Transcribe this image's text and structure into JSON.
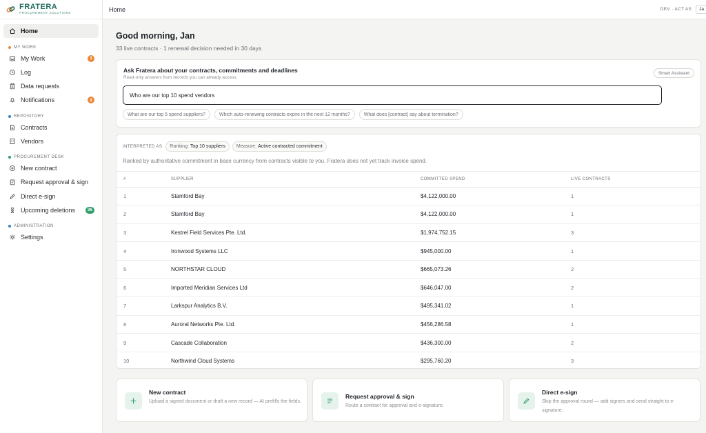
{
  "app": {
    "logo_name": "FRATERA",
    "logo_tagline": "PROCUREMENT SOLUTIONS"
  },
  "colors": {
    "accent": "#1f6b5c",
    "badge_orange": "#e8893a",
    "badge_green": "#2f9e6a",
    "section_my_work": "#e8893a",
    "section_repository": "#3b82c4",
    "section_procurement": "#2f9e6a",
    "section_admin": "#3b82c4"
  },
  "sidebar": {
    "home": {
      "label": "Home",
      "icon": "home-icon"
    },
    "sections": {
      "my_work": "MY WORK",
      "repository": "REPOSITORY",
      "procurement": "PROCUREMENT DESK",
      "admin": "ADMINISTRATION"
    },
    "my_work": [
      {
        "label": "My Work",
        "icon": "inbox-icon",
        "badge": "1"
      },
      {
        "label": "Log",
        "icon": "clock-icon"
      },
      {
        "label": "Data requests",
        "icon": "clipboard-icon"
      },
      {
        "label": "Notifications",
        "icon": "bell-icon",
        "badge": "2"
      }
    ],
    "repository": [
      {
        "label": "Contracts",
        "icon": "document-icon"
      },
      {
        "label": "Vendors",
        "icon": "building-icon"
      }
    ],
    "procurement": [
      {
        "label": "New contract",
        "icon": "plus-circle-icon"
      },
      {
        "label": "Request approval & sign",
        "icon": "clipboard-check-icon"
      },
      {
        "label": "Direct e-sign",
        "icon": "pen-icon"
      },
      {
        "label": "Upcoming deletions",
        "icon": "hourglass-icon",
        "badge": "36"
      }
    ],
    "admin": [
      {
        "label": "Settings",
        "icon": "gear-icon"
      }
    ]
  },
  "topbar": {
    "breadcrumb": "Home",
    "env": "DEV · ACT AS",
    "user": "Ja"
  },
  "main": {
    "greeting": "Good morning, Jan",
    "summary": "33 live contracts · 1 renewal decision needed in 30 days"
  },
  "ask": {
    "title": "Ask Fratera about your contracts, commitments and deadlines",
    "subtitle": "Read-only answers from records you can already access.",
    "smart_assistant": "Smart Assistant",
    "input_value": "Who are our top 10 spend vendors",
    "suggestions": [
      "What are our top 5 spend suppliers?",
      "Which auto-renewing contracts expire in the next 12 months?",
      "What does [contract] say about termination?"
    ]
  },
  "results": {
    "interpreted_label": "INTERPRETED AS",
    "tags": [
      {
        "k": "Ranking:",
        "v": "Top 10 suppliers"
      },
      {
        "k": "Measure:",
        "v": "Active contracted commitment"
      }
    ],
    "note": "Ranked by authoritative commitment in base currency from contracts visible to you. Fratera does not yet track invoice spend.",
    "columns": [
      "#",
      "SUPPLIER",
      "COMMITTED SPEND",
      "LIVE CONTRACTS"
    ],
    "rows": [
      {
        "n": "1",
        "supplier": "Stamford Bay",
        "spend": "$4,122,000.00",
        "live": "1"
      },
      {
        "n": "2",
        "supplier": "Stamford Bay",
        "spend": "$4,122,000.00",
        "live": "1"
      },
      {
        "n": "3",
        "supplier": "Kestrel Field Services Pte. Ltd.",
        "spend": "$1,974,752.15",
        "live": "3"
      },
      {
        "n": "4",
        "supplier": "Ironwood Systems LLC",
        "spend": "$945,000.00",
        "live": "1"
      },
      {
        "n": "5",
        "supplier": "NORTHSTAR CLOUD",
        "spend": "$665,073.26",
        "live": "2"
      },
      {
        "n": "6",
        "supplier": "Imported Meridian Services Ltd",
        "spend": "$646,047.00",
        "live": "2"
      },
      {
        "n": "7",
        "supplier": "Larkspur Analytics B.V.",
        "spend": "$495,341.02",
        "live": "1"
      },
      {
        "n": "8",
        "supplier": "Auroral Networks Pte. Ltd.",
        "spend": "$456,286.58",
        "live": "1"
      },
      {
        "n": "9",
        "supplier": "Cascade Collaboration",
        "spend": "$436,300.00",
        "live": "2"
      },
      {
        "n": "10",
        "supplier": "Northwind Cloud Systems",
        "spend": "$295,760.20",
        "live": "3"
      }
    ]
  },
  "actions": [
    {
      "title": "New contract",
      "desc": "Upload a signed document or draft a new record — AI prefills the fields.",
      "icon": "plus-icon"
    },
    {
      "title": "Request approval & sign",
      "desc": "Route a contract for approval and e-signature.",
      "icon": "list-icon"
    },
    {
      "title": "Direct e-sign",
      "desc": "Skip the approval round — add signers and send straight to e-signature.",
      "icon": "pen-icon"
    }
  ]
}
